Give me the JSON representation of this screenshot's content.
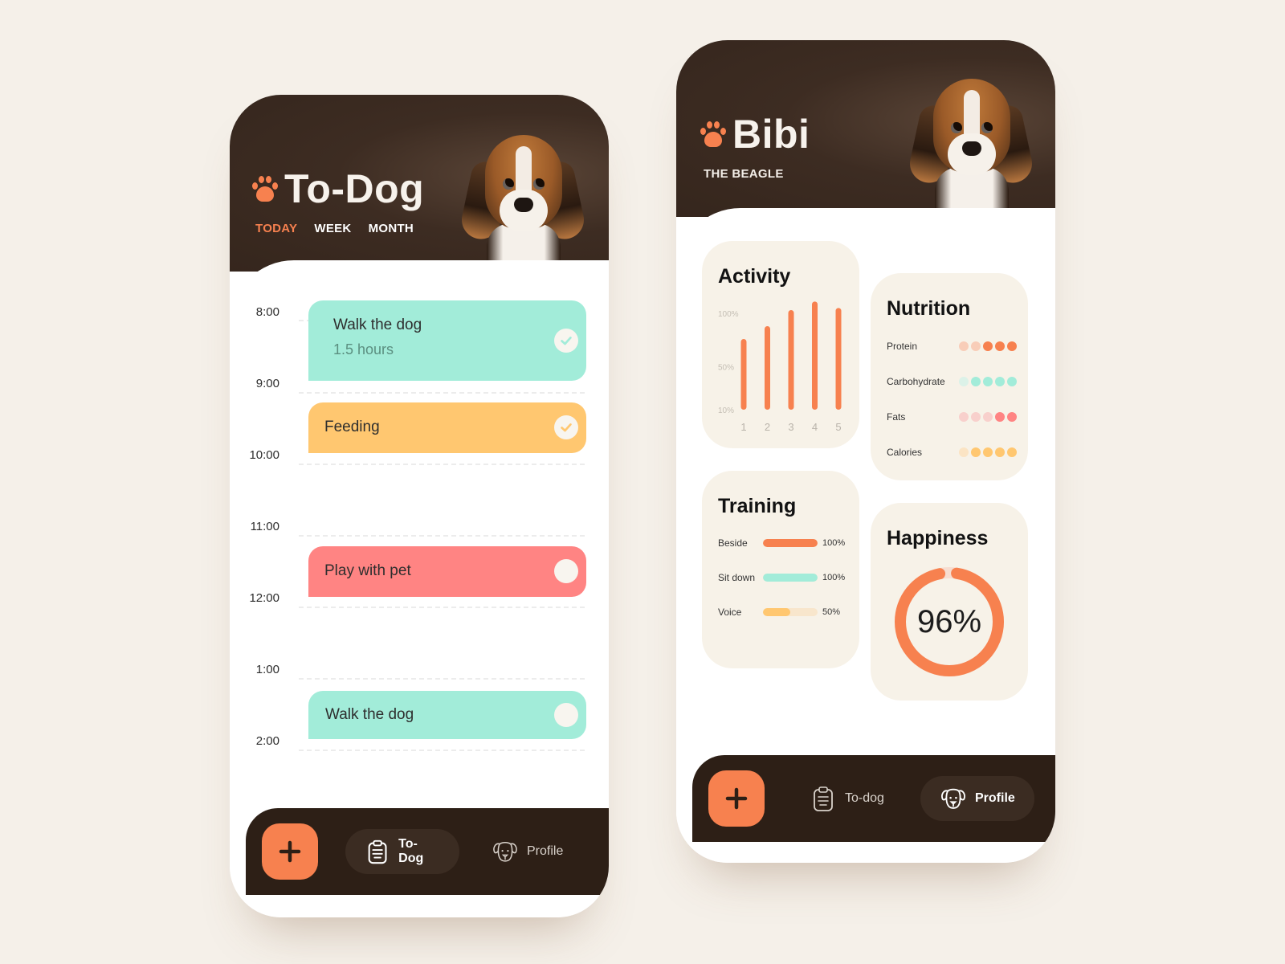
{
  "colors": {
    "accent": "#f7814f",
    "header_dark": "#3d2c22",
    "nav_dark": "#2d1f16",
    "mint": "#a2ecd9",
    "yellow": "#ffc770",
    "pink": "#ff8483",
    "card_bg": "#f7f2e8"
  },
  "todo_screen": {
    "title": "To-Dog",
    "tabs": [
      {
        "label": "TODAY",
        "active": true
      },
      {
        "label": "WEEK",
        "active": false
      },
      {
        "label": "MONTH",
        "active": false
      }
    ],
    "hours": [
      "8:00",
      "9:00",
      "10:00",
      "11:00",
      "12:00",
      "1:00",
      "2:00"
    ],
    "tasks": [
      {
        "title": "Walk the dog",
        "subtitle": "1.5 hours",
        "color": "mint",
        "done": true
      },
      {
        "title": "Feeding",
        "subtitle": "",
        "color": "yellow",
        "done": true
      },
      {
        "title": "Play with pet",
        "subtitle": "",
        "color": "pink",
        "done": false
      },
      {
        "title": "Walk the dog",
        "subtitle": "",
        "color": "mint",
        "done": false
      }
    ],
    "nav": {
      "add_icon": "plus-icon",
      "items": [
        {
          "label": "To-Dog",
          "icon": "clipboard-icon",
          "active": true
        },
        {
          "label": "Profile",
          "icon": "dog-face-icon",
          "active": false
        }
      ]
    }
  },
  "profile_screen": {
    "name": "Bibi",
    "breed": "THE BEAGLE",
    "activity": {
      "title": "Activity"
    },
    "nutrition": {
      "title": "Nutrition",
      "rows": [
        {
          "label": "Protein",
          "filled": 3,
          "total": 5,
          "color": "#f7814f",
          "light": "#f8cdb8"
        },
        {
          "label": "Carbohydrate",
          "filled": 4,
          "total": 5,
          "color": "#a2ecd9",
          "light": "#dcf2e8"
        },
        {
          "label": "Fats",
          "filled": 2,
          "total": 5,
          "color": "#ff8483",
          "light": "#f8d0cc"
        },
        {
          "label": "Calories",
          "filled": 4,
          "total": 5,
          "color": "#ffc770",
          "light": "#fbe4c4"
        }
      ]
    },
    "training": {
      "title": "Training",
      "rows": [
        {
          "label": "Beside",
          "value": 100,
          "display": "100%",
          "color": "#f7814f"
        },
        {
          "label": "Sit down",
          "value": 100,
          "display": "100%",
          "color": "#a2ecd9"
        },
        {
          "label": "Voice",
          "value": 50,
          "display": "50%",
          "color": "#ffc770"
        }
      ]
    },
    "happiness": {
      "title": "Happiness",
      "value": 96,
      "display": "96%"
    },
    "nav": {
      "add_icon": "plus-icon",
      "items": [
        {
          "label": "To-dog",
          "icon": "clipboard-icon",
          "active": false
        },
        {
          "label": "Profile",
          "icon": "dog-face-icon",
          "active": true
        }
      ]
    }
  },
  "chart_data": {
    "type": "bar",
    "title": "Activity",
    "categories": [
      "1",
      "2",
      "3",
      "4",
      "5"
    ],
    "values": [
      76,
      88,
      103,
      111,
      105
    ],
    "ytick_labels": [
      "100%",
      "50%",
      "10%"
    ],
    "yticks": [
      100,
      50,
      10
    ],
    "ylim": [
      10,
      100
    ],
    "xlabel": "",
    "ylabel": "",
    "grid": false,
    "color": "#f7814f"
  }
}
